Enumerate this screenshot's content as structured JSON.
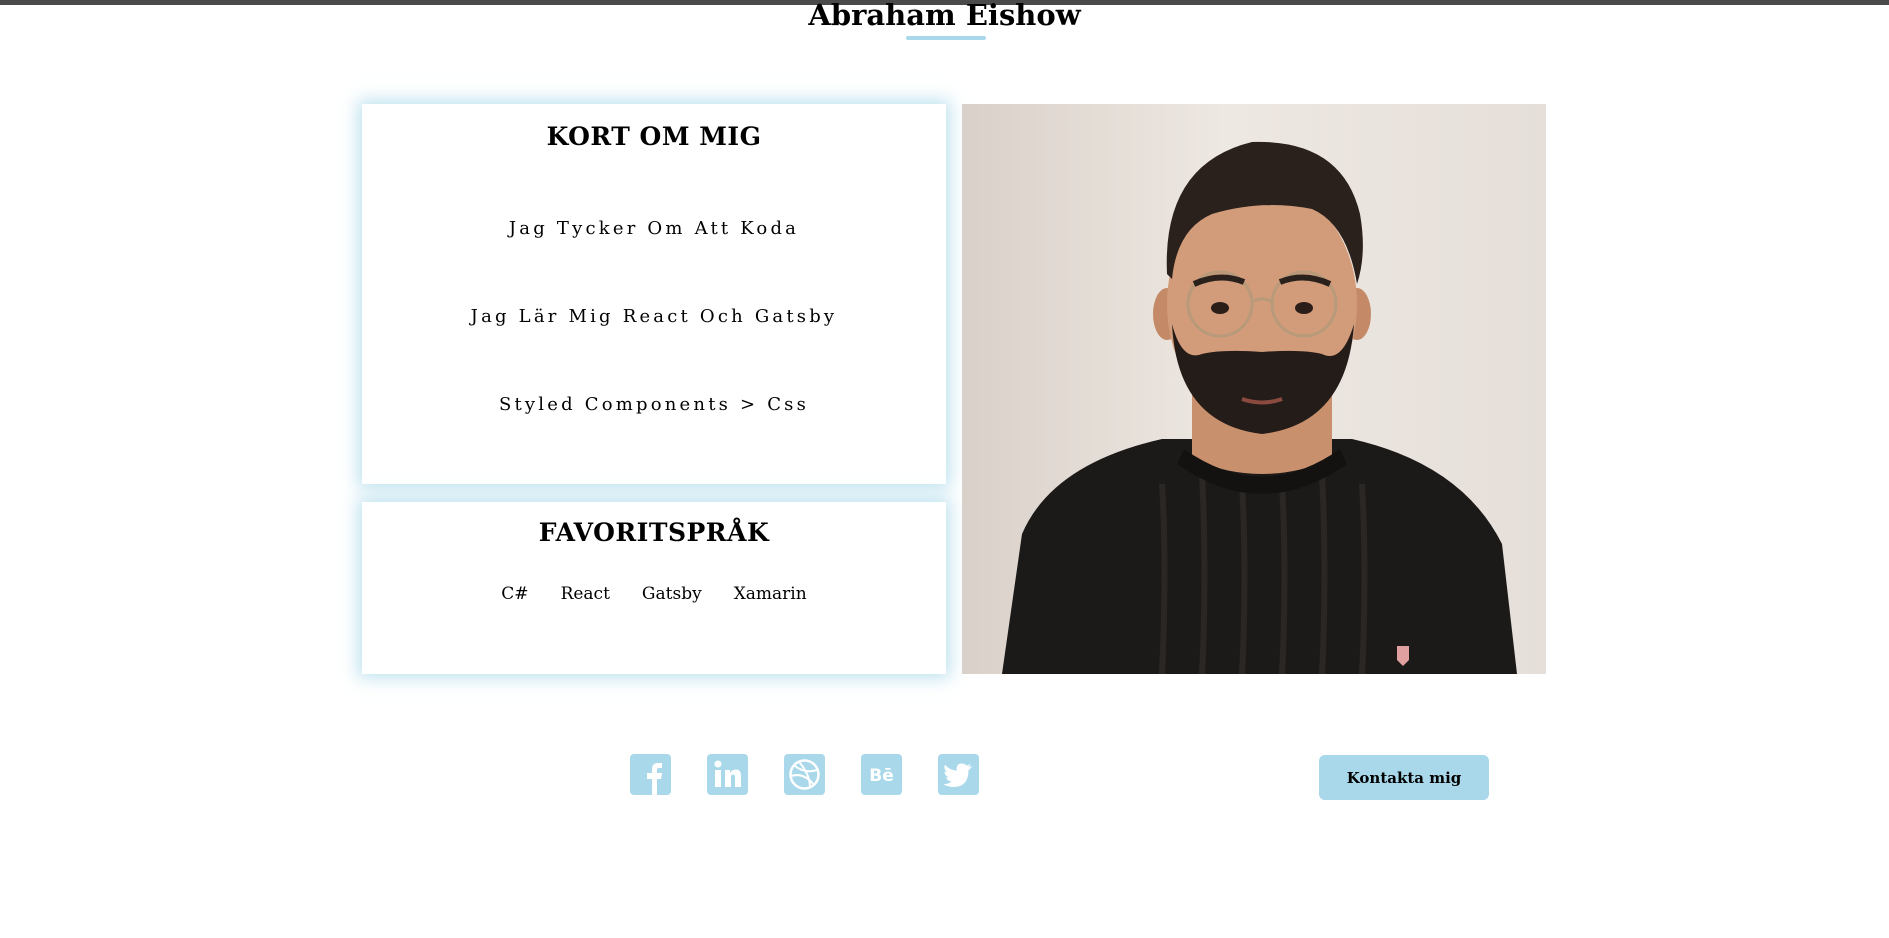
{
  "header": {
    "title": "Abraham Eishow"
  },
  "about": {
    "heading": "KORT OM MIG",
    "lines": [
      "Jag Tycker Om Att Koda",
      "Jag Lär Mig React Och Gatsby",
      "Styled Components > Css"
    ]
  },
  "languages": {
    "heading": "FAVORITSPRÅK",
    "items": [
      "C#",
      "React",
      "Gatsby",
      "Xamarin"
    ]
  },
  "social": {
    "icons": [
      "facebook-icon",
      "linkedin-icon",
      "dribbble-icon",
      "behance-icon",
      "twitter-icon"
    ],
    "behance_text": "Bē",
    "linkedin_text": "in"
  },
  "contact": {
    "button_label": "Kontakta mig"
  },
  "colors": {
    "accent": "#a8d8ea",
    "background": "#ffffff",
    "text": "#000000"
  }
}
